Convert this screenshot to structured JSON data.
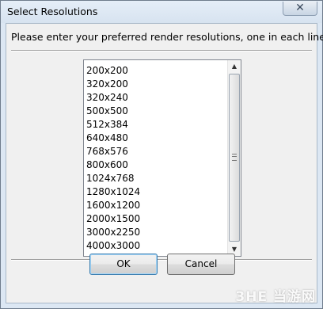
{
  "window": {
    "title": "Select Resolutions",
    "close_icon": "close-icon"
  },
  "dialog": {
    "instruction": "Please enter your preferred render resolutions, one in each line.",
    "resolutions": [
      "200x200",
      "320x200",
      "320x240",
      "500x500",
      "512x384",
      "640x480",
      "768x576",
      "800x600",
      "1024x768",
      "1280x1024",
      "1600x1200",
      "2000x1500",
      "3000x2250",
      "4000x3000"
    ],
    "ok_label": "OK",
    "cancel_label": "Cancel"
  },
  "watermark": {
    "text": "3HE 当游网"
  },
  "colors": {
    "title_bar": "#dce7f3",
    "client_bg": "#f0f0f0",
    "ok_focus_border": "#3c7fb1"
  }
}
